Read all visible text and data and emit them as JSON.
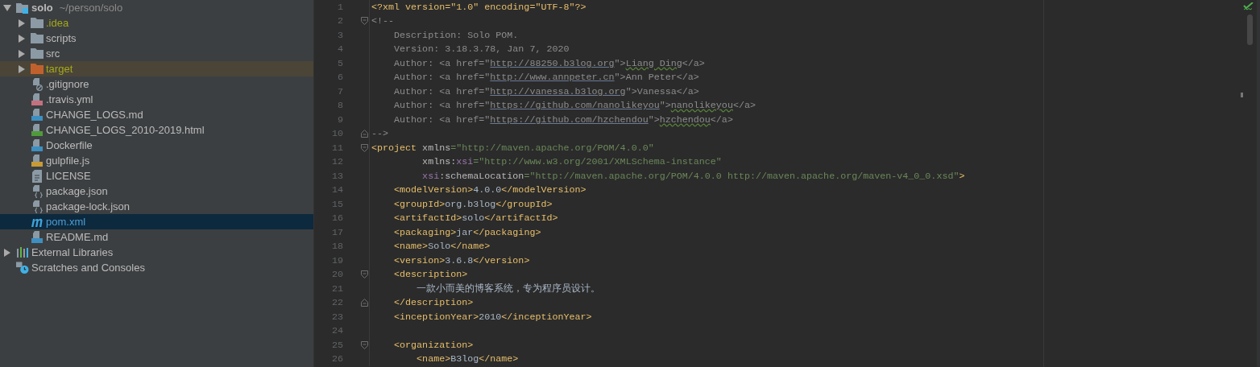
{
  "project_tree": {
    "items": [
      {
        "label": "solo",
        "path": "~/person/solo",
        "kind": "module",
        "expanded": true,
        "selected": false,
        "ignored": false,
        "highlighted": false,
        "children": [
          {
            "label": ".idea",
            "kind": "folder",
            "expanded": false,
            "selected": false,
            "ignored": true,
            "highlighted": false
          },
          {
            "label": "scripts",
            "kind": "folder",
            "expanded": false,
            "selected": false,
            "ignored": false,
            "highlighted": false
          },
          {
            "label": "src",
            "kind": "folder",
            "expanded": false,
            "selected": false,
            "ignored": false,
            "highlighted": false
          },
          {
            "label": "target",
            "kind": "excluded-folder",
            "expanded": false,
            "selected": false,
            "ignored": true,
            "highlighted": true
          },
          {
            "label": ".gitignore",
            "kind": "ignore-file",
            "selected": false,
            "ignored": false,
            "highlighted": false
          },
          {
            "label": ".travis.yml",
            "kind": "yml-file",
            "selected": false,
            "ignored": false,
            "highlighted": false
          },
          {
            "label": "CHANGE_LOGS.md",
            "kind": "md-file",
            "selected": false,
            "ignored": false,
            "highlighted": false
          },
          {
            "label": "CHANGE_LOGS_2010-2019.html",
            "kind": "html-file",
            "selected": false,
            "ignored": false,
            "highlighted": false
          },
          {
            "label": "Dockerfile",
            "kind": "docker-file",
            "selected": false,
            "ignored": false,
            "highlighted": false
          },
          {
            "label": "gulpfile.js",
            "kind": "js-file",
            "selected": false,
            "ignored": false,
            "highlighted": false
          },
          {
            "label": "LICENSE",
            "kind": "text-file",
            "selected": false,
            "ignored": false,
            "highlighted": false
          },
          {
            "label": "package.json",
            "kind": "json-file",
            "selected": false,
            "ignored": false,
            "highlighted": false
          },
          {
            "label": "package-lock.json",
            "kind": "json-file",
            "selected": false,
            "ignored": false,
            "highlighted": false
          },
          {
            "label": "pom.xml",
            "kind": "maven-file",
            "selected": true,
            "ignored": false,
            "highlighted": false
          },
          {
            "label": "README.md",
            "kind": "md-file",
            "selected": false,
            "ignored": false,
            "highlighted": false
          }
        ]
      },
      {
        "label": "External Libraries",
        "kind": "libraries",
        "expanded": false,
        "selected": false,
        "ignored": false,
        "highlighted": false
      },
      {
        "label": "Scratches and Consoles",
        "kind": "scratches",
        "selected": false,
        "ignored": false,
        "highlighted": false
      }
    ]
  },
  "editor": {
    "lines": [
      {
        "number": "1",
        "fold_start": false,
        "fold_end": false,
        "segments": [
          {
            "kind": "tag",
            "text": "<?xml version=\"1.0\" encoding=\"UTF-8\"?>"
          }
        ]
      },
      {
        "number": "2",
        "fold_start": true,
        "fold_end": false,
        "segments": [
          {
            "kind": "comment",
            "text": "<!--"
          }
        ]
      },
      {
        "number": "3",
        "fold_start": false,
        "fold_end": false,
        "segments": [
          {
            "kind": "comment",
            "text": "    Description: Solo POM."
          }
        ]
      },
      {
        "number": "4",
        "fold_start": false,
        "fold_end": false,
        "segments": [
          {
            "kind": "comment",
            "text": "    Version: 3.18.3.78, Jan 7, 2020"
          }
        ]
      },
      {
        "number": "5",
        "fold_start": false,
        "fold_end": false,
        "segments": [
          {
            "kind": "comment",
            "text": "    Author: <a href=\""
          },
          {
            "kind": "link",
            "text": "http://88250.b3log.org"
          },
          {
            "kind": "comment",
            "text": "\">"
          },
          {
            "kind": "typo",
            "text": "Liang Ding"
          },
          {
            "kind": "comment",
            "text": "</a>"
          }
        ]
      },
      {
        "number": "6",
        "fold_start": false,
        "fold_end": false,
        "segments": [
          {
            "kind": "comment",
            "text": "    Author: <a href=\""
          },
          {
            "kind": "link",
            "text": "http://www.annpeter.cn"
          },
          {
            "kind": "comment",
            "text": "\">Ann Peter</a>"
          }
        ]
      },
      {
        "number": "7",
        "fold_start": false,
        "fold_end": false,
        "segments": [
          {
            "kind": "comment",
            "text": "    Author: <a href=\""
          },
          {
            "kind": "link",
            "text": "http://vanessa.b3log.org"
          },
          {
            "kind": "comment",
            "text": "\">Vanessa</a>"
          }
        ]
      },
      {
        "number": "8",
        "fold_start": false,
        "fold_end": false,
        "segments": [
          {
            "kind": "comment",
            "text": "    Author: <a href=\""
          },
          {
            "kind": "link",
            "text": "https://github.com/nanolikeyou"
          },
          {
            "kind": "comment",
            "text": "\">"
          },
          {
            "kind": "typo",
            "text": "nanolikeyou"
          },
          {
            "kind": "comment",
            "text": "</a>"
          }
        ]
      },
      {
        "number": "9",
        "fold_start": false,
        "fold_end": false,
        "segments": [
          {
            "kind": "comment",
            "text": "    Author: <a href=\""
          },
          {
            "kind": "link",
            "text": "https://github.com/hzchendou"
          },
          {
            "kind": "comment",
            "text": "\">"
          },
          {
            "kind": "typo",
            "text": "hzchendou"
          },
          {
            "kind": "comment",
            "text": "</a>"
          }
        ]
      },
      {
        "number": "10",
        "fold_start": false,
        "fold_end": true,
        "segments": [
          {
            "kind": "comment",
            "text": "-->"
          }
        ]
      },
      {
        "number": "11",
        "fold_start": true,
        "fold_end": false,
        "segments": [
          {
            "kind": "tag",
            "text": "<project"
          },
          {
            "kind": "attr",
            "text": " xmlns"
          },
          {
            "kind": "value",
            "text": "=\"http://maven.apache.org/POM/4.0.0\""
          }
        ]
      },
      {
        "number": "12",
        "fold_start": false,
        "fold_end": false,
        "segments": [
          {
            "kind": "attr",
            "text": "         xmlns:"
          },
          {
            "kind": "namespace",
            "text": "xsi"
          },
          {
            "kind": "value",
            "text": "=\"http://www.w3.org/2001/XMLSchema-instance\""
          }
        ]
      },
      {
        "number": "13",
        "fold_start": false,
        "fold_end": false,
        "segments": [
          {
            "kind": "namespace",
            "text": "         xsi"
          },
          {
            "kind": "attr",
            "text": ":schemaLocation"
          },
          {
            "kind": "value",
            "text": "=\"http://maven.apache.org/POM/4.0.0 http://maven.apache.org/maven-v4_0_0.xsd\""
          },
          {
            "kind": "tag",
            "text": ">"
          }
        ]
      },
      {
        "number": "14",
        "fold_start": false,
        "fold_end": false,
        "segments": [
          {
            "kind": "tag",
            "text": "    <modelVersion>"
          },
          {
            "kind": "text",
            "text": "4.0.0"
          },
          {
            "kind": "tag",
            "text": "</modelVersion>"
          }
        ]
      },
      {
        "number": "15",
        "fold_start": false,
        "fold_end": false,
        "segments": [
          {
            "kind": "tag",
            "text": "    <groupId>"
          },
          {
            "kind": "text",
            "text": "org.b3log"
          },
          {
            "kind": "tag",
            "text": "</groupId>"
          }
        ]
      },
      {
        "number": "16",
        "fold_start": false,
        "fold_end": false,
        "segments": [
          {
            "kind": "tag",
            "text": "    <artifactId>"
          },
          {
            "kind": "text",
            "text": "solo"
          },
          {
            "kind": "tag",
            "text": "</artifactId>"
          }
        ]
      },
      {
        "number": "17",
        "fold_start": false,
        "fold_end": false,
        "segments": [
          {
            "kind": "tag",
            "text": "    <packaging>"
          },
          {
            "kind": "text",
            "text": "jar"
          },
          {
            "kind": "tag",
            "text": "</packaging>"
          }
        ]
      },
      {
        "number": "18",
        "fold_start": false,
        "fold_end": false,
        "segments": [
          {
            "kind": "tag",
            "text": "    <name>"
          },
          {
            "kind": "text",
            "text": "Solo"
          },
          {
            "kind": "tag",
            "text": "</name>"
          }
        ]
      },
      {
        "number": "19",
        "fold_start": false,
        "fold_end": false,
        "segments": [
          {
            "kind": "tag",
            "text": "    <version>"
          },
          {
            "kind": "text",
            "text": "3.6.8"
          },
          {
            "kind": "tag",
            "text": "</version>"
          }
        ]
      },
      {
        "number": "20",
        "fold_start": true,
        "fold_end": false,
        "segments": [
          {
            "kind": "tag",
            "text": "    <description>"
          }
        ]
      },
      {
        "number": "21",
        "fold_start": false,
        "fold_end": false,
        "segments": [
          {
            "kind": "text",
            "text": "        一款小而美的博客系统，专为程序员设计。"
          }
        ]
      },
      {
        "number": "22",
        "fold_start": false,
        "fold_end": true,
        "segments": [
          {
            "kind": "tag",
            "text": "    </description>"
          }
        ]
      },
      {
        "number": "23",
        "fold_start": false,
        "fold_end": false,
        "segments": [
          {
            "kind": "tag",
            "text": "    <inceptionYear>"
          },
          {
            "kind": "text",
            "text": "2010"
          },
          {
            "kind": "tag",
            "text": "</inceptionYear>"
          }
        ]
      },
      {
        "number": "24",
        "fold_start": false,
        "fold_end": false
      },
      {
        "number": "25",
        "fold_start": true,
        "fold_end": false,
        "segments": [
          {
            "kind": "tag",
            "text": "    <organization>"
          }
        ]
      },
      {
        "number": "26",
        "fold_start": false,
        "fold_end": false,
        "segments": [
          {
            "kind": "tag",
            "text": "        <name>"
          },
          {
            "kind": "text",
            "text": "B3log"
          },
          {
            "kind": "tag",
            "text": "</name>"
          }
        ]
      }
    ]
  }
}
